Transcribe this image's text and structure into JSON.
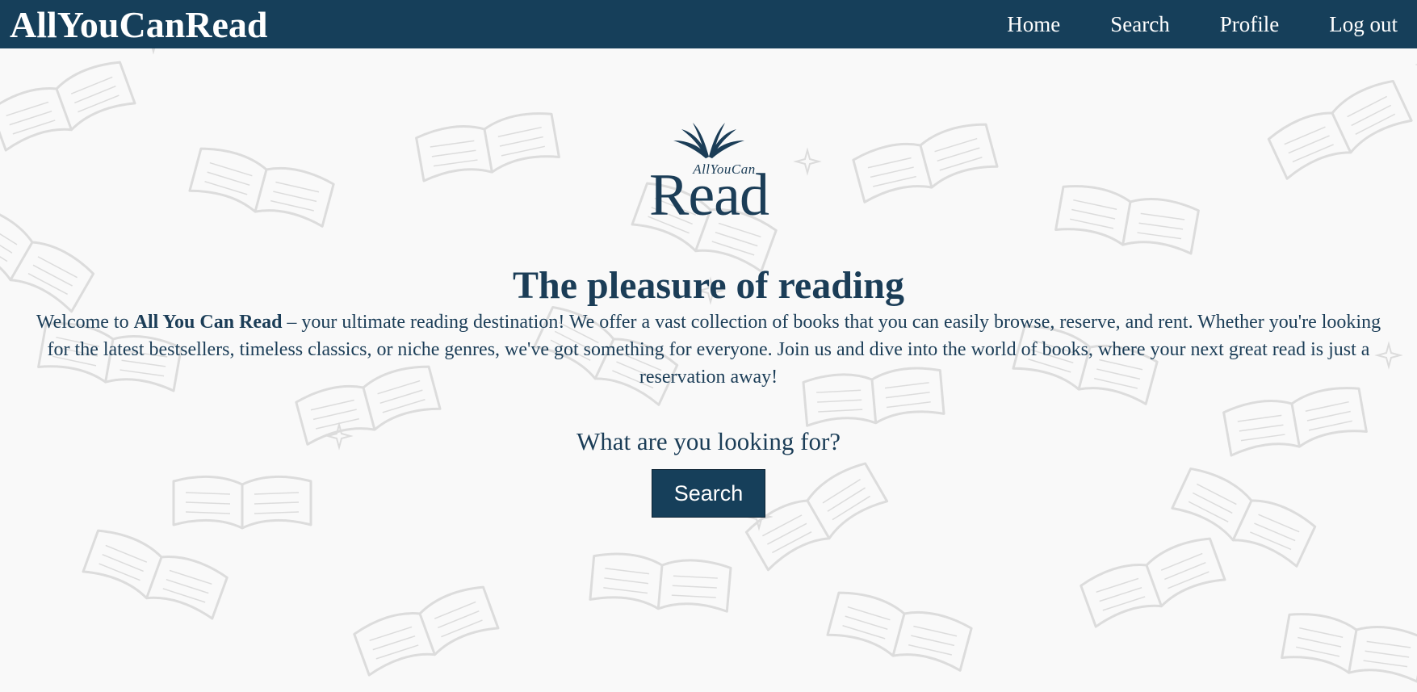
{
  "colors": {
    "primary": "#163f5a",
    "text": "#1b3d57",
    "background": "#f9f9f9",
    "pattern_stroke": "#dcdcdc"
  },
  "header": {
    "brand": "AllYouCanRead",
    "nav": [
      {
        "label": "Home"
      },
      {
        "label": "Search"
      },
      {
        "label": "Profile"
      },
      {
        "label": "Log out"
      }
    ]
  },
  "logo": {
    "icon": "open-book-icon",
    "small_text": "AllYouCan",
    "big_text": "Read"
  },
  "main": {
    "headline": "The pleasure of reading",
    "intro": {
      "before": "Welcome to ",
      "bold": "All You Can Read",
      "after": " – your ultimate reading destination! We offer a vast collection of books that you can easily browse, reserve, and rent. Whether you're looking for the latest bestsellers, timeless classics, or niche genres, we've got something for everyone. Join us and dive into the world of books, where your next great read is just a reservation away!"
    },
    "prompt": "What are you looking for?",
    "search_button": "Search"
  }
}
